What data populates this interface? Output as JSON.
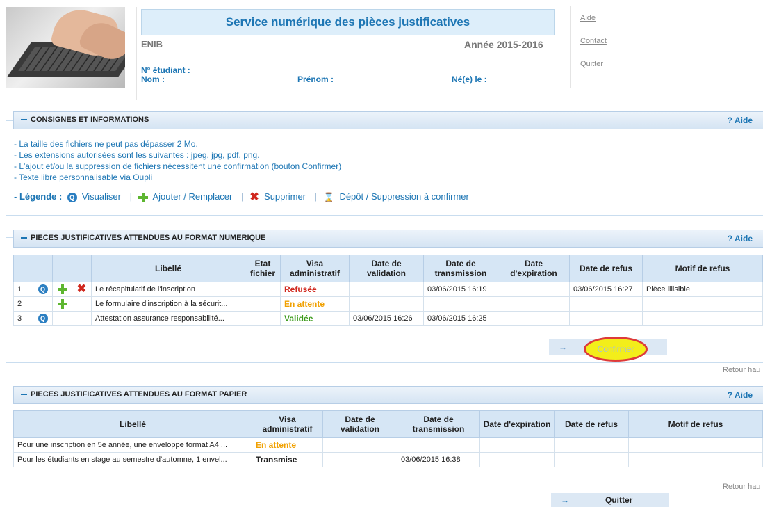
{
  "header": {
    "title": "Service numérique des pièces justificatives",
    "org": "ENIB",
    "year": "Année 2015-2016",
    "student_no_label": "N° étudiant :",
    "nom_label": "Nom :",
    "prenom_label": "Prénom :",
    "ne_le_label": "Né(e) le :"
  },
  "side_links": [
    "Aide",
    "Contact",
    "Quitter"
  ],
  "consignes": {
    "title": "CONSIGNES ET INFORMATIONS",
    "aide": "? Aide",
    "lines": [
      "- La taille des fichiers ne peut pas dépasser 2 Mo.",
      "- Les extensions autorisées sont les suivantes : jpeg, jpg, pdf, png.",
      "- L'ajout et/ou la suppression de fichiers nécessitent une confirmation (bouton Confirmer)",
      "- Texte libre personnalisable via Oupli"
    ],
    "legend_prefix": "- ",
    "legend_label": "Légende :",
    "legend_items": [
      "Visualiser",
      "Ajouter / Remplacer",
      "Supprimer",
      "Dépôt / Suppression à confirmer"
    ]
  },
  "numeric": {
    "title": "PIECES JUSTIFICATIVES ATTENDUES AU FORMAT NUMERIQUE",
    "aide": "? Aide",
    "columns": [
      "Libellé",
      "Etat fichier",
      "Visa administratif",
      "Date de validation",
      "Date de transmission",
      "Date d'expiration",
      "Date de refus",
      "Motif de refus"
    ],
    "rows": [
      {
        "num": "1",
        "label": "Le récapitulatif de l'inscription",
        "etat": "",
        "visa": "Refusée",
        "validation": "",
        "transmission": "03/06/2015 16:19",
        "expiration": "",
        "refus": "03/06/2015 16:27",
        "motif": "Pièce illisible"
      },
      {
        "num": "2",
        "label": "Le formulaire d'inscription à la sécurit...",
        "etat": "",
        "visa": "En attente",
        "validation": "",
        "transmission": "",
        "expiration": "",
        "refus": "",
        "motif": ""
      },
      {
        "num": "3",
        "label": "Attestation assurance responsabilité...",
        "etat": "",
        "visa": "Validée",
        "validation": "03/06/2015 16:26",
        "transmission": "03/06/2015 16:25",
        "expiration": "",
        "refus": "",
        "motif": ""
      }
    ],
    "confirm_label": "Confirmer",
    "retour": "Retour hau"
  },
  "paper": {
    "title": "PIECES JUSTIFICATIVES ATTENDUES AU FORMAT PAPIER",
    "aide": "? Aide",
    "columns": [
      "Libellé",
      "Visa administratif",
      "Date de validation",
      "Date de transmission",
      "Date d'expiration",
      "Date de refus",
      "Motif de refus"
    ],
    "rows": [
      {
        "label": "Pour une inscription en 5e année, une enveloppe format A4 ...",
        "visa": "En attente",
        "validation": "",
        "transmission": "",
        "expiration": "",
        "refus": "",
        "motif": ""
      },
      {
        "label": "Pour les étudiants en stage au semestre d'automne, 1 envel...",
        "visa": "Transmise",
        "validation": "",
        "transmission": "03/06/2015 16:38",
        "expiration": "",
        "refus": "",
        "motif": ""
      }
    ],
    "retour": "Retour hau"
  },
  "quit_label": "Quitter"
}
